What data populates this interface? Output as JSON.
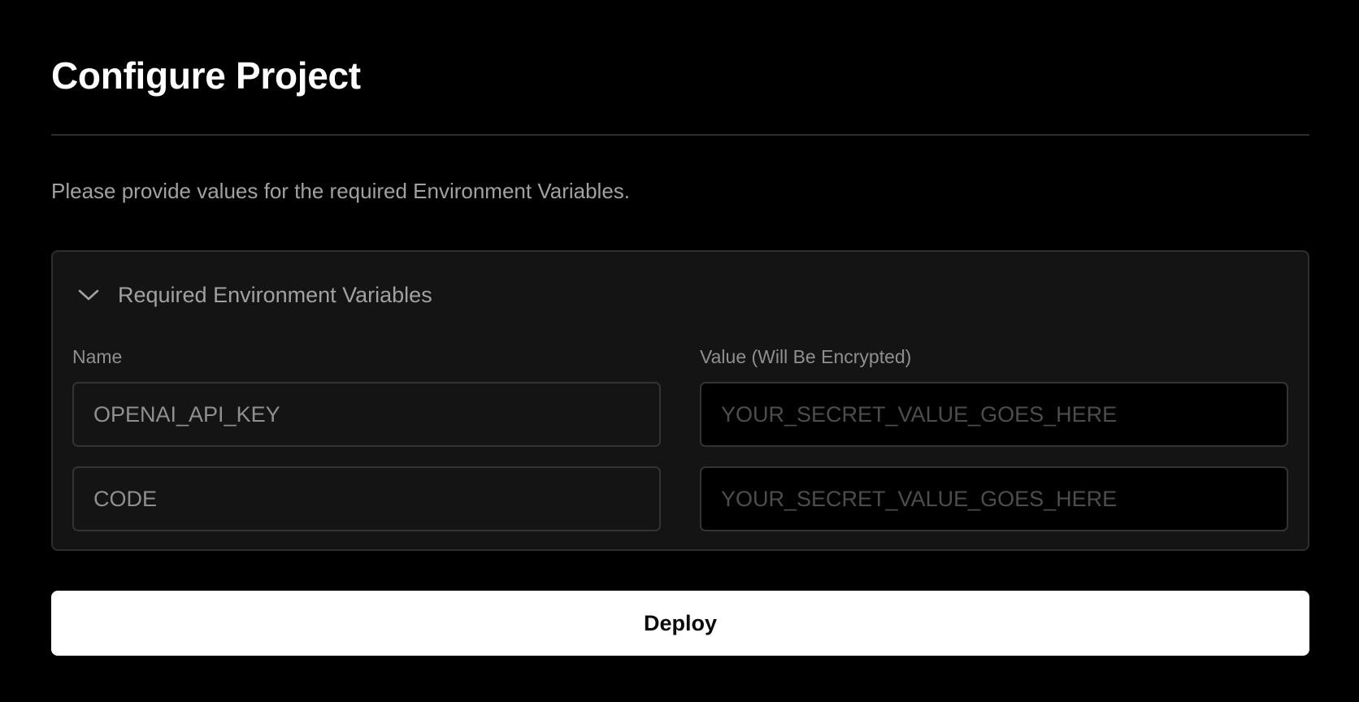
{
  "page": {
    "title": "Configure Project",
    "description": "Please provide values for the required Environment Variables."
  },
  "env_section": {
    "title": "Required Environment Variables",
    "expanded": true,
    "toggle_icon": "chevron-down-icon",
    "name_label": "Name",
    "value_label": "Value (Will Be Encrypted)",
    "rows": [
      {
        "name": "OPENAI_API_KEY",
        "value": "",
        "value_placeholder": "YOUR_SECRET_VALUE_GOES_HERE"
      },
      {
        "name": "CODE",
        "value": "",
        "value_placeholder": "YOUR_SECRET_VALUE_GOES_HERE"
      }
    ]
  },
  "actions": {
    "deploy_label": "Deploy"
  },
  "colors": {
    "background": "#000000",
    "panel": "#141414",
    "border": "#2e2e2e",
    "primary_button": "#ffffff"
  }
}
